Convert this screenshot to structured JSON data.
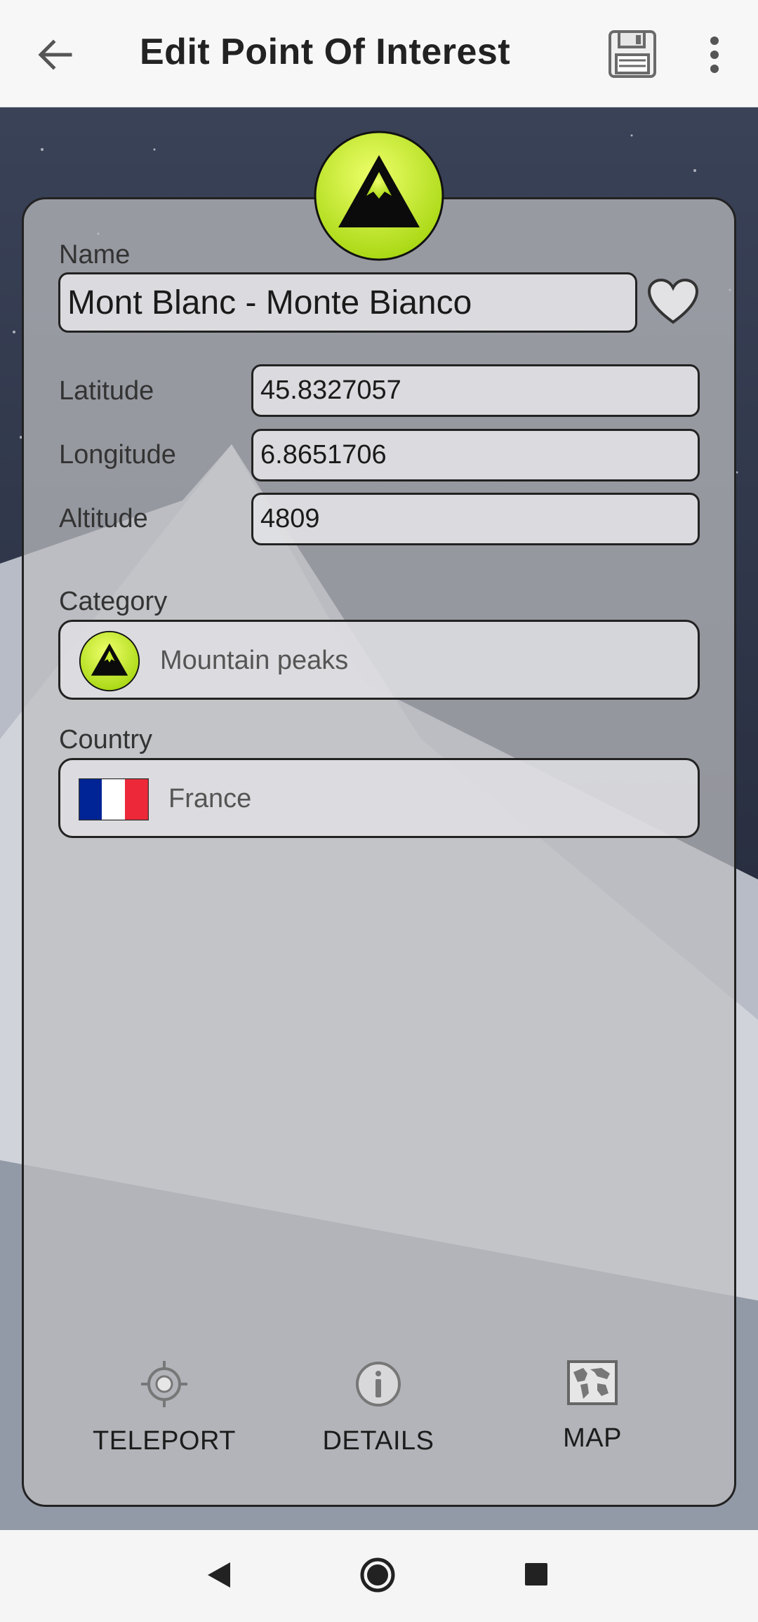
{
  "header": {
    "title": "Edit Point Of Interest",
    "back_icon": "arrow-left-icon",
    "save_icon": "floppy-disk-icon",
    "menu_icon": "more-vert-icon"
  },
  "form": {
    "name_label": "Name",
    "name_value": "Mont Blanc - Monte Bianco",
    "latitude_label": "Latitude",
    "latitude_value": "45.8327057",
    "longitude_label": "Longitude",
    "longitude_value": "6.8651706",
    "altitude_label": "Altitude",
    "altitude_value": "4809",
    "category_label": "Category",
    "category_value": "Mountain peaks",
    "country_label": "Country",
    "country_value": "France"
  },
  "actions": {
    "teleport": "TELEPORT",
    "details": "DETAILS",
    "map": "MAP"
  },
  "colors": {
    "poi_badge": "#c8ec2a",
    "flag_blue": "#002395",
    "flag_white": "#ffffff",
    "flag_red": "#ed2939"
  }
}
